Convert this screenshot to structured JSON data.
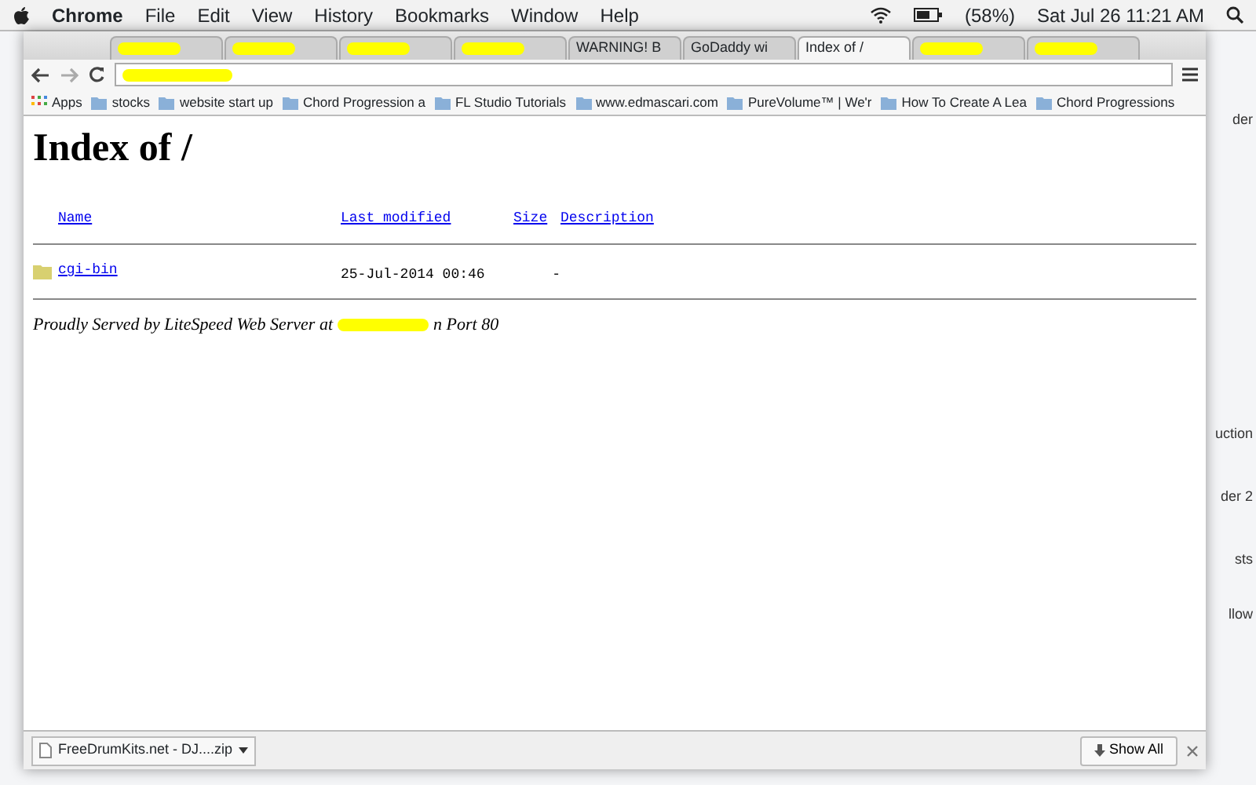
{
  "menu_bar": {
    "app": "Chrome",
    "menus": [
      "File",
      "Edit",
      "View",
      "History",
      "Bookmarks",
      "Window",
      "Help"
    ],
    "battery": "(58%)",
    "clock": "Sat Jul 26  11:21 AM"
  },
  "tabs": [
    {
      "redacted": true,
      "selected": false
    },
    {
      "redacted": true,
      "selected": false
    },
    {
      "redacted": true,
      "selected": false
    },
    {
      "redacted": true,
      "selected": false
    },
    {
      "title": "WARNING! B",
      "redacted": false,
      "selected": false
    },
    {
      "title": "GoDaddy wi",
      "redacted": false,
      "selected": false
    },
    {
      "title": "Index of /",
      "redacted": false,
      "selected": true
    },
    {
      "redacted": true,
      "selected": false
    },
    {
      "redacted": true,
      "selected": false
    }
  ],
  "address_bar": {
    "redacted": true
  },
  "bookmarks": [
    "Apps",
    "stocks",
    "website start up",
    "Chord Progression a",
    "FL Studio Tutorials",
    "www.edmascari.com",
    "PureVolume™ | We'r",
    "How To Create A Lea",
    "Chord Progressions"
  ],
  "page": {
    "heading": "Index of /",
    "columns": [
      "Name",
      "Last modified",
      "Size",
      "Description"
    ],
    "rows": [
      {
        "name": "cgi-bin",
        "modified": "25-Jul-2014 00:46",
        "size": "-"
      }
    ],
    "footer_before": "Proudly Served by LiteSpeed Web Server at",
    "footer_after": "n Port 80"
  },
  "downloads": {
    "file": "FreeDrumKits.net - DJ....zip",
    "show_all": "Show All"
  },
  "desktop_labels": [
    "der",
    "uction",
    "der 2",
    "sts",
    "llow"
  ]
}
